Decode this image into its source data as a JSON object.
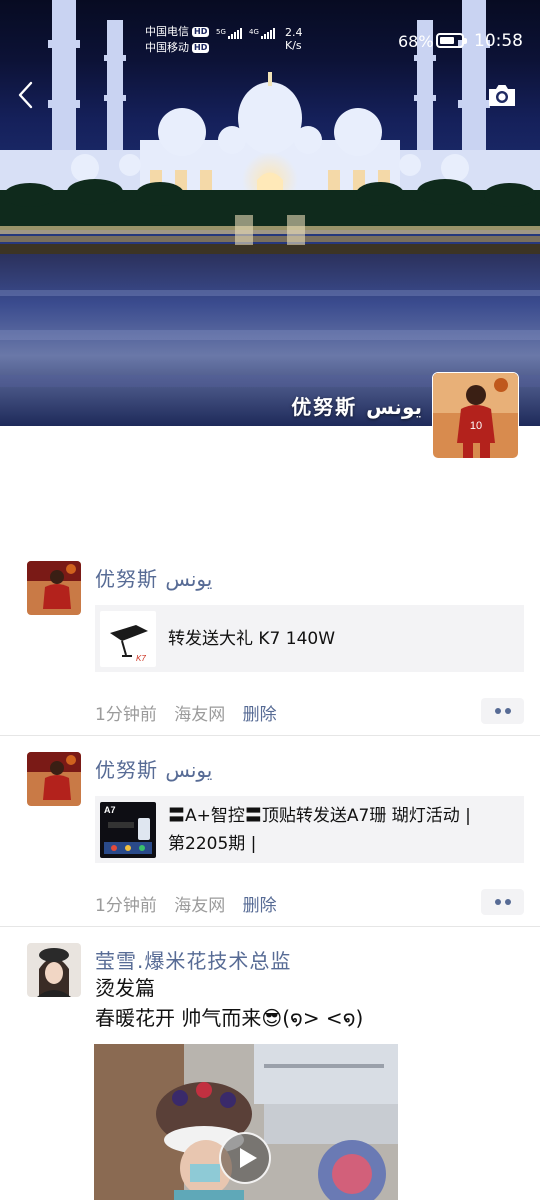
{
  "status_bar": {
    "carrier_1": "中国电信",
    "carrier_2": "中国移动",
    "hd_badge": "HD",
    "sim1_network": "5G",
    "sim2_network": "4G",
    "net_speed_value": "2.4",
    "net_speed_unit": "K/s",
    "battery_percent": "68%",
    "battery_level": 0.68,
    "time": "10:58"
  },
  "header": {
    "back_icon": "chevron-left-icon",
    "camera_icon": "camera-icon",
    "profile_name": "优努斯 يونس"
  },
  "posts": [
    {
      "author": "优努斯 يونس",
      "link_title": "转发送大礼 K7 140W",
      "time": "1分钟前",
      "source": "海友网",
      "delete_label": "删除"
    },
    {
      "author": "优努斯 يونس",
      "link_title_line1": "〓A+智控〓顶贴转发送A7珊 瑚灯活动 |",
      "link_title_line2": "第2205期 |",
      "thumb_label": "A7",
      "time": "1分钟前",
      "source": "海友网",
      "delete_label": "删除"
    },
    {
      "author": "莹雪.爆米花技术总监",
      "text_line1": "烫发篇",
      "text_line2": "春暖花开   帅气而来😎(໑>   <໑)",
      "media": "video"
    }
  ],
  "colors": {
    "link_blue": "#576b95",
    "meta_gray": "#9b9b9b",
    "card_bg": "#f3f3f5"
  }
}
